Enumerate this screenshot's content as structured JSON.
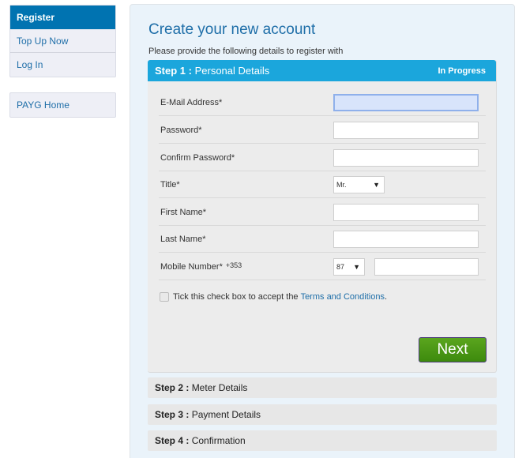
{
  "sidebar": {
    "group1": [
      {
        "label": "Register",
        "active": true
      },
      {
        "label": "Top Up Now",
        "active": false
      },
      {
        "label": "Log In",
        "active": false
      }
    ],
    "group2": [
      {
        "label": "PAYG Home",
        "active": false
      }
    ]
  },
  "main": {
    "title": "Create your new account",
    "subtitle": "Please provide the following details to register with",
    "step1": {
      "prefix": "Step 1 :",
      "name": "Personal Details",
      "status": "In Progress",
      "fields": {
        "email": {
          "label": "E-Mail Address*",
          "value": ""
        },
        "password": {
          "label": "Password*",
          "value": ""
        },
        "confirm_password": {
          "label": "Confirm Password*",
          "value": ""
        },
        "title": {
          "label": "Title*",
          "selected": "Mr."
        },
        "first_name": {
          "label": "First Name*",
          "value": ""
        },
        "last_name": {
          "label": "Last Name*",
          "value": ""
        },
        "mobile": {
          "label": "Mobile Number*",
          "country_code": "+353",
          "prefix_selected": "87",
          "value": ""
        }
      },
      "terms": {
        "text": "Tick this check box to accept the",
        "link": "Terms and Conditions",
        "suffix": ".",
        "checked": false
      },
      "next_label": "Next"
    },
    "steps": [
      {
        "prefix": "Step 2 :",
        "name": "Meter Details"
      },
      {
        "prefix": "Step 3 :",
        "name": "Payment Details"
      },
      {
        "prefix": "Step 4 :",
        "name": "Confirmation"
      }
    ]
  },
  "colors": {
    "brand_blue": "#0073b1",
    "step_header": "#1ba6dc",
    "link": "#1e6ea8",
    "next_green": "#4a9616"
  },
  "icons": {
    "dropdown": "▼"
  }
}
